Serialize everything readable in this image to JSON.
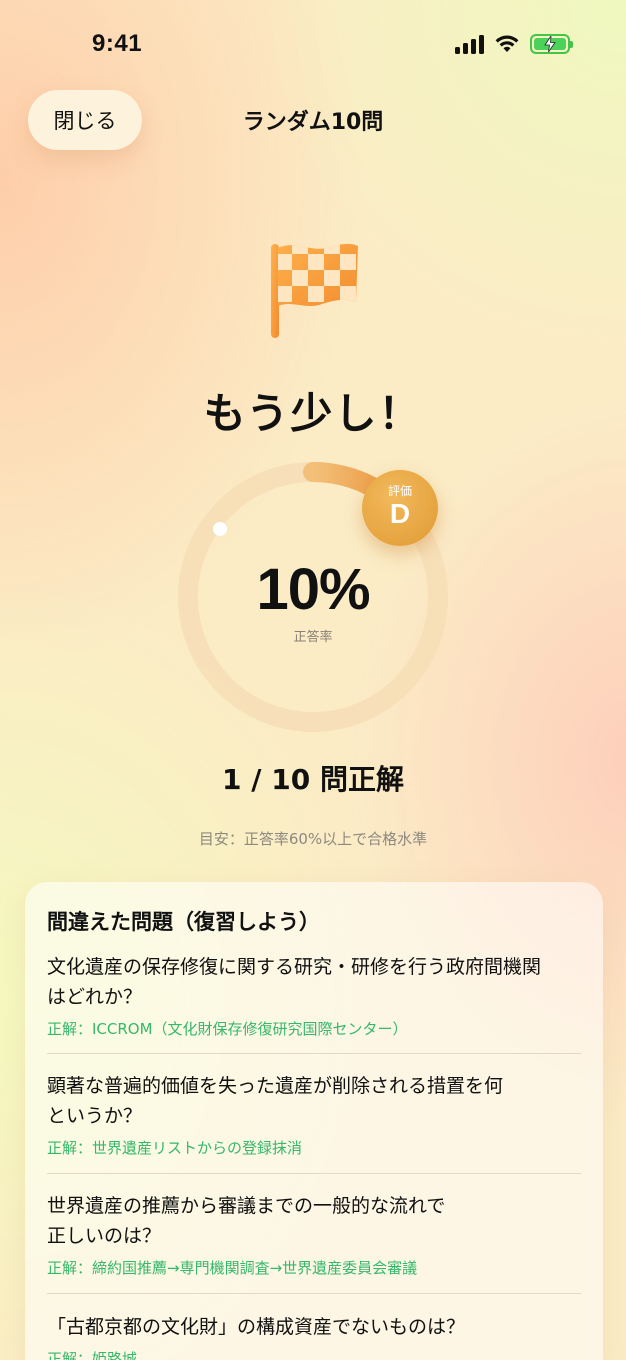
{
  "status": {
    "time": "9:41"
  },
  "nav": {
    "close_label": "閉じる",
    "title": "ランダム10問"
  },
  "result": {
    "headline": "もう少し！",
    "percent_text": "10%",
    "percent_value": 10,
    "percent_label": "正答率",
    "grade_label": "評価",
    "grade": "D",
    "score_text": "1 / 10 問正解",
    "hint": "目安：正答率60%以上で合格水準"
  },
  "review": {
    "title": "間違えた問題（復習しよう）",
    "items": [
      {
        "question_line1": "文化遺産の保存修復に関する研究・研修を行う政府間機関",
        "question_line2": "はどれか？",
        "answer": "正解：ICCROM（文化財保存修復研究国際センター）"
      },
      {
        "question_line1": "顕著な普遍的価値を失った遺産が削除される措置を何",
        "question_line2": "というか？",
        "answer": "正解：世界遺産リストからの登録抹消"
      },
      {
        "question_line1": "世界遺産の推薦から審議までの一般的な流れで",
        "question_line2": "正しいのは？",
        "answer": "正解：締約国推薦→専門機関調査→世界遺産委員会審議"
      },
      {
        "question_line1": "「古都京都の文化財」の構成資産でないものは？",
        "question_line2": "",
        "answer": "正解：姫路城"
      }
    ]
  },
  "colors": {
    "accent": "#e9a43c",
    "correct": "#35b86a",
    "ring_track": "#f5dcb4",
    "flag": "#f6a33f"
  }
}
